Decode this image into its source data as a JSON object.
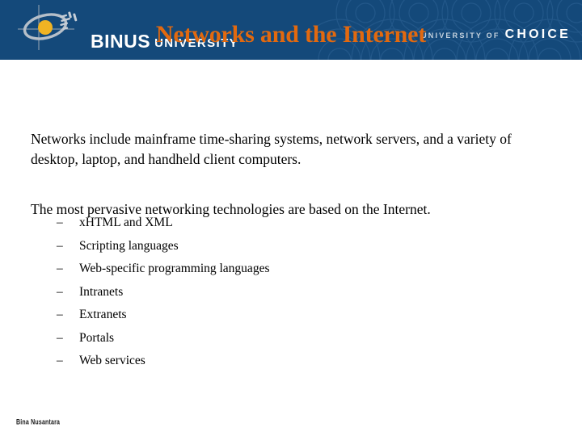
{
  "slide": {
    "title": "Networks and the Internet",
    "title_color": "#e2690f",
    "background_color": "#ffffff"
  },
  "banner": {
    "background_color": "#14497a",
    "logo": {
      "mark_icon": "binus-logo-icon",
      "mark_accent_color": "#f0b323",
      "mark_swoosh_color": "#9aa6b4",
      "brand": "BINUS",
      "brand_suffix": "UNIVERSITY"
    },
    "tagline": {
      "small": "UNIVERSITY OF",
      "big": "CHOICE"
    },
    "decoration_icon": "concentric-arcs-pattern"
  },
  "content": {
    "paragraphs": [
      "Networks include mainframe time-sharing systems, network servers, and a variety of desktop, laptop, and handheld client computers.",
      "The most pervasive networking technologies are based on the Internet."
    ],
    "bullet_marker": "–",
    "bullets": [
      "xHTML and XML",
      "Scripting languages",
      "Web-specific programming languages",
      "Intranets",
      "Extranets",
      "Portals",
      "Web services"
    ]
  },
  "footer": {
    "note": "Bina Nusantara"
  }
}
